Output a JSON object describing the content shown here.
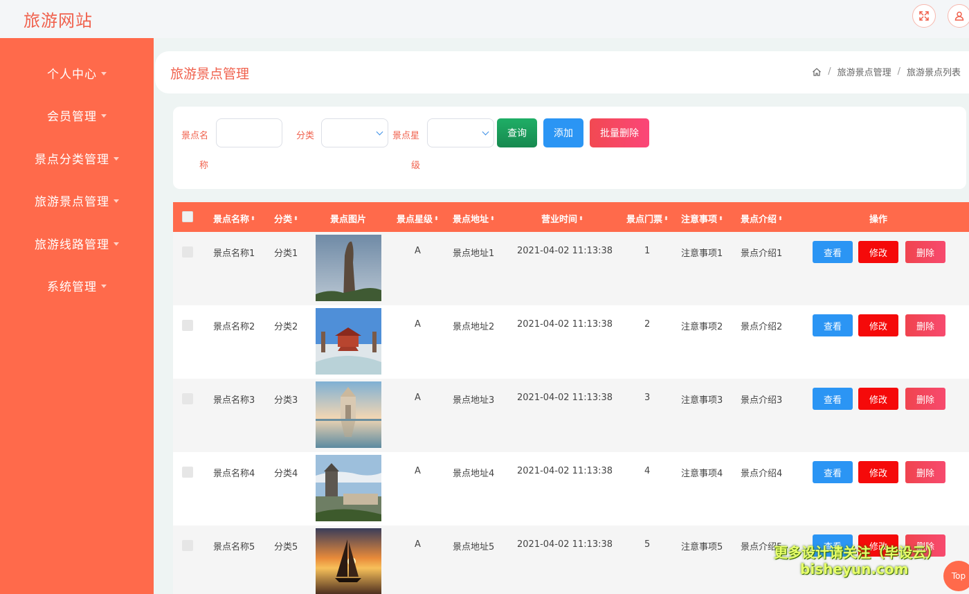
{
  "header": {
    "title": "旅游网站",
    "fullscreen_icon": "expand-icon",
    "user_icon": "user-icon"
  },
  "sidebar": {
    "items": [
      {
        "label": "个人中心"
      },
      {
        "label": "会员管理"
      },
      {
        "label": "景点分类管理"
      },
      {
        "label": "旅游景点管理"
      },
      {
        "label": "旅游线路管理"
      },
      {
        "label": "系统管理"
      }
    ]
  },
  "page": {
    "title": "旅游景点管理",
    "breadcrumb": [
      "旅游景点管理",
      "旅游景点列表"
    ]
  },
  "search": {
    "name_label_1": "景点名",
    "name_label_2": "称",
    "name_value": "",
    "category_label": "分类",
    "category_value": "",
    "star_label_1": "景点星",
    "star_label_2": "级",
    "star_value": "",
    "query_label": "查询",
    "add_label": "添加",
    "batch_delete_label": "批量删除"
  },
  "table": {
    "headers": [
      "景点名称",
      "分类",
      "景点图片",
      "景点星级",
      "景点地址",
      "营业时间",
      "景点门票",
      "注意事项",
      "景点介绍",
      "操作"
    ],
    "rows": [
      {
        "name": "景点名称1",
        "category": "分类1",
        "star": "A",
        "address": "景点地址1",
        "hours": "2021-04-02 11:13:38",
        "ticket": "1",
        "notes": "注意事项1",
        "intro": "景点介绍1"
      },
      {
        "name": "景点名称2",
        "category": "分类2",
        "star": "A",
        "address": "景点地址2",
        "hours": "2021-04-02 11:13:38",
        "ticket": "2",
        "notes": "注意事项2",
        "intro": "景点介绍2"
      },
      {
        "name": "景点名称3",
        "category": "分类3",
        "star": "A",
        "address": "景点地址3",
        "hours": "2021-04-02 11:13:38",
        "ticket": "3",
        "notes": "注意事项3",
        "intro": "景点介绍3"
      },
      {
        "name": "景点名称4",
        "category": "分类4",
        "star": "A",
        "address": "景点地址4",
        "hours": "2021-04-02 11:13:38",
        "ticket": "4",
        "notes": "注意事项4",
        "intro": "景点介绍4"
      },
      {
        "name": "景点名称5",
        "category": "分类5",
        "star": "A",
        "address": "景点地址5",
        "hours": "2021-04-02 11:13:38",
        "ticket": "5",
        "notes": "注意事项5",
        "intro": "景点介绍5"
      }
    ],
    "actions": {
      "view": "查看",
      "edit": "修改",
      "delete": "删除"
    }
  },
  "overlay": {
    "watermark_line1": "更多设计请关注（毕设云）",
    "watermark_line2": "bisheyun.com",
    "top_label": "Top"
  },
  "colors": {
    "accent": "#ff6a4b",
    "title_red": "#f0614d",
    "query_green": "#1a9f5c",
    "add_blue": "#2b95f4",
    "batch_delete_red": "#f7465f",
    "view_blue": "#2b95f4",
    "edit_red": "#f50a0a",
    "delete_pink": "#f2465a"
  }
}
